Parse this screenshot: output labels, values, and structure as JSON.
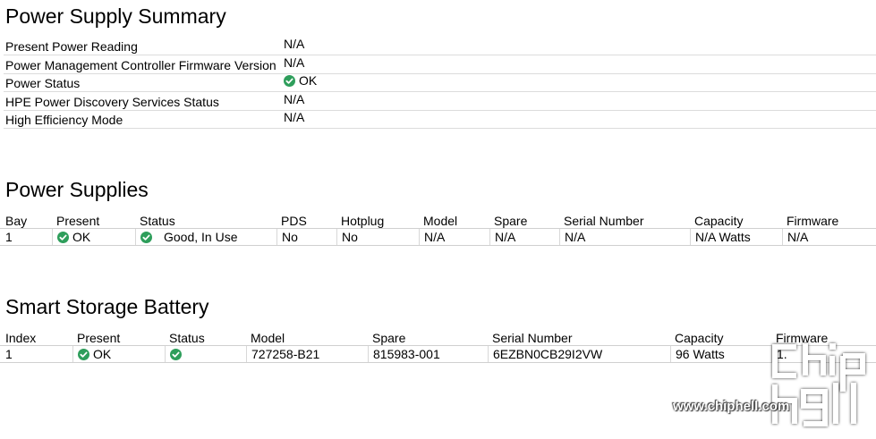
{
  "colors": {
    "ok": "#2e9e5b",
    "border": "#dcdcdc"
  },
  "summary": {
    "title": "Power Supply Summary",
    "rows": [
      {
        "label": "Present Power Reading",
        "value": "N/A"
      },
      {
        "label": "Power Management Controller Firmware Version",
        "value": "N/A"
      },
      {
        "label": "Power Status",
        "value": "OK",
        "icon": "check-circle-icon"
      },
      {
        "label": "HPE Power Discovery Services Status",
        "value": "N/A"
      },
      {
        "label": "High Efficiency Mode",
        "value": "N/A"
      }
    ]
  },
  "supplies": {
    "title": "Power Supplies",
    "headers": [
      "Bay",
      "Present",
      "Status",
      "PDS",
      "Hotplug",
      "Model",
      "Spare",
      "Serial Number",
      "Capacity",
      "Firmware"
    ],
    "rows": [
      {
        "bay": "1",
        "present": "OK",
        "status": "Good, In Use",
        "pds": "No",
        "hotplug": "No",
        "model": "N/A",
        "spare": "N/A",
        "serial": "N/A",
        "capacity": "N/A Watts",
        "firmware": "N/A"
      }
    ]
  },
  "battery": {
    "title": "Smart Storage Battery",
    "headers": [
      "Index",
      "Present",
      "Status",
      "Model",
      "Spare",
      "Serial Number",
      "Capacity",
      "Firmware"
    ],
    "rows": [
      {
        "index": "1",
        "present": "OK",
        "status": "",
        "model": "727258-B21",
        "spare": "815983-001",
        "serial": "6EZBN0CB29I2VW",
        "capacity": "96 Watts",
        "firmware": "1."
      }
    ]
  },
  "watermark": {
    "url": "www.chiphell.com",
    "logo": "chiphell-logo"
  }
}
